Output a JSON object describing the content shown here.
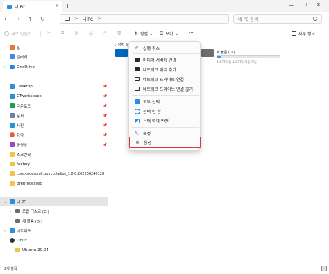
{
  "window": {
    "tab_title": "내 PC",
    "tab_close": "×",
    "new_tab": "+",
    "minimize": "—",
    "maximize": "☐",
    "close": "✕"
  },
  "nav": {
    "back": "←",
    "forward": "→",
    "up": "↑",
    "refresh": "↻",
    "breadcrumb": "내 PC",
    "breadcrumb_sep": ">",
    "search_placeholder": "내 PC 검색"
  },
  "toolbar": {
    "new_label": "새로 만들기",
    "sort_label": "정렬",
    "view_label": "보기",
    "more_label": "···",
    "details_label": "세부 정보"
  },
  "sidebar": {
    "items": [
      {
        "label": "홈",
        "icon": "home-icon",
        "color": "#e8743b"
      },
      {
        "label": "갤러리",
        "icon": "gallery-icon",
        "color": "#3b8ee8"
      },
      {
        "label": "OneDrive",
        "icon": "cloud-icon",
        "color": "#1e88e5"
      },
      {
        "label": "Desktop",
        "icon": "desktop-folder-icon",
        "color": "#2d8fd5"
      },
      {
        "label": "CTworkspace",
        "icon": "folder-icon",
        "color": "#2d8fd5"
      },
      {
        "label": "다운로드",
        "icon": "download-icon",
        "color": "#1f9d55"
      },
      {
        "label": "문서",
        "icon": "document-icon",
        "color": "#6b7fa8"
      },
      {
        "label": "사진",
        "icon": "pictures-icon",
        "color": "#2b8fe0"
      },
      {
        "label": "음악",
        "icon": "music-icon",
        "color": "#e85d3b"
      },
      {
        "label": "동영상",
        "icon": "video-icon",
        "color": "#8b4fd6"
      },
      {
        "label": "스크린샷",
        "icon": "folder-icon",
        "color": "#f2c14e"
      },
      {
        "label": "factory",
        "icon": "folder-icon",
        "color": "#f2c14e"
      },
      {
        "label": "com.codescroll.gp.rcp.helios_1.0.0.202206240128",
        "icon": "folder-icon",
        "color": "#f2c14e"
      },
      {
        "label": "preprocessed",
        "icon": "folder-icon",
        "color": "#f2c14e"
      },
      {
        "label": "내 PC",
        "icon": "pc-icon",
        "color": "#2b8fe0"
      },
      {
        "label": "로컬 디스크 (C:)",
        "icon": "drive-icon",
        "color": "#6d6d6d"
      },
      {
        "label": "새 볼륨 (D:)",
        "icon": "drive-icon",
        "color": "#6d6d6d"
      },
      {
        "label": "네트워크",
        "icon": "network-icon",
        "color": "#2b8fe0"
      },
      {
        "label": "Linux",
        "icon": "linux-icon",
        "color": "#333333"
      },
      {
        "label": "Ubuntu-20.04",
        "icon": "folder-icon",
        "color": "#f2c14e"
      }
    ]
  },
  "content": {
    "group_header": "장치 및",
    "drive_d": {
      "name": "새 볼륨 (D:)",
      "size": "1.67TB 중 1.83TB 사용 가능",
      "used_fraction": 0.06
    }
  },
  "menu": {
    "items": [
      {
        "label": "실행 취소",
        "icon": "undo-icon"
      },
      {
        "label": "미디어 서버에 연결",
        "icon": "media-server-icon"
      },
      {
        "label": "네트워크 위치 추가",
        "icon": "network-location-icon"
      },
      {
        "label": "네트워크 드라이브 연결",
        "icon": "map-drive-icon"
      },
      {
        "label": "네트워크 드라이브 연결 끊기",
        "icon": "disconnect-drive-icon"
      },
      {
        "label": "모두 선택",
        "icon": "select-all-icon"
      },
      {
        "label": "선택 안 함",
        "icon": "select-none-icon"
      },
      {
        "label": "선택 영역 반전",
        "icon": "invert-selection-icon"
      },
      {
        "label": "속성",
        "icon": "properties-icon"
      },
      {
        "label": "옵션",
        "icon": "options-icon"
      }
    ]
  },
  "status": {
    "text": "2개 항목"
  },
  "colors": {
    "accent": "#0067c0",
    "highlight_border": "#d9393d",
    "selected_bg": "#e5e5e5"
  }
}
